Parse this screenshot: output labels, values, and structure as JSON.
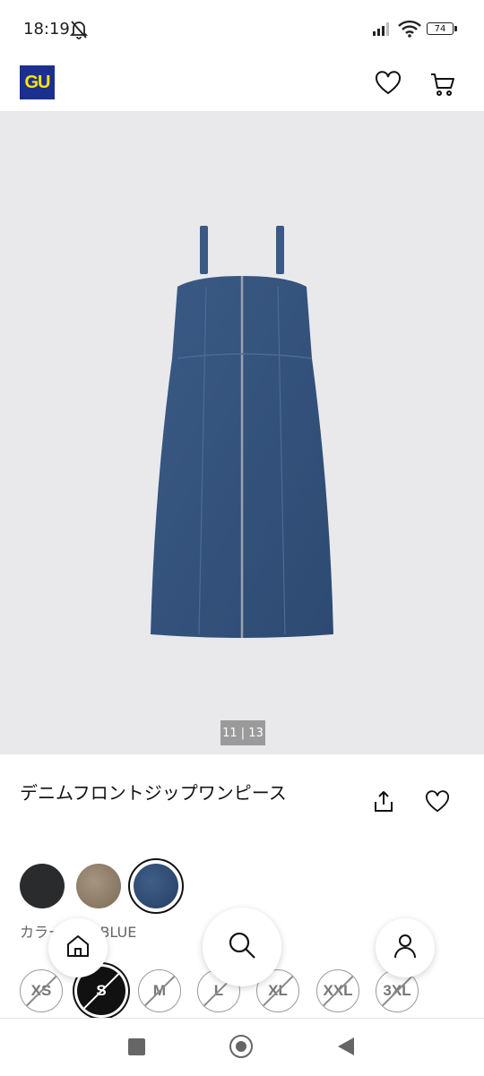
{
  "status_bar": {
    "time": "18:19",
    "battery": "74"
  },
  "header": {
    "logo": "GU"
  },
  "gallery": {
    "counter": "11 | 13"
  },
  "product": {
    "title": "デニムフロントジップワンピース"
  },
  "colors": {
    "label": "カラー：65 BLUE",
    "swatches": [
      "#2a2b2c",
      "#8f7f6a",
      "#2f4c73"
    ]
  },
  "sizes": [
    {
      "label": "XS",
      "available": false
    },
    {
      "label": "S",
      "available": false,
      "selected": true
    },
    {
      "label": "M",
      "available": false
    },
    {
      "label": "L",
      "available": false
    },
    {
      "label": "XL",
      "available": false
    },
    {
      "label": "XXL",
      "available": false
    },
    {
      "label": "3XL",
      "available": false
    }
  ],
  "icons": {
    "home": "home-icon",
    "search": "search-icon",
    "user": "user-icon",
    "heart": "heart-icon",
    "cart": "cart-icon",
    "share": "share-icon"
  }
}
